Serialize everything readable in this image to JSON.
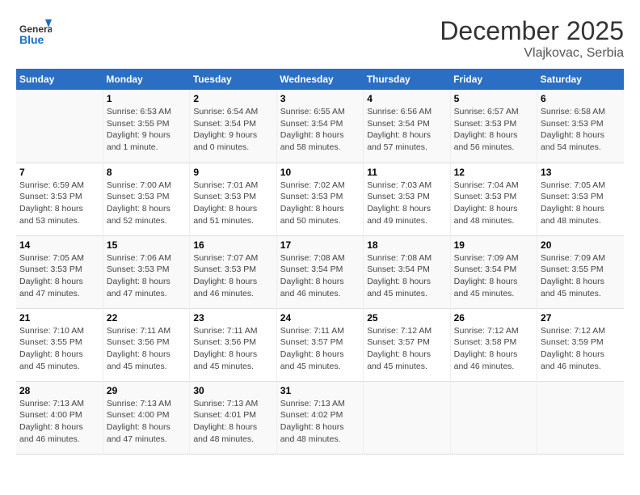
{
  "header": {
    "logo_line1": "General",
    "logo_line2": "Blue",
    "month": "December 2025",
    "location": "Vlajkovac, Serbia"
  },
  "days_of_week": [
    "Sunday",
    "Monday",
    "Tuesday",
    "Wednesday",
    "Thursday",
    "Friday",
    "Saturday"
  ],
  "weeks": [
    [
      {
        "day": "",
        "info": ""
      },
      {
        "day": "1",
        "info": "Sunrise: 6:53 AM\nSunset: 3:55 PM\nDaylight: 9 hours\nand 1 minute."
      },
      {
        "day": "2",
        "info": "Sunrise: 6:54 AM\nSunset: 3:54 PM\nDaylight: 9 hours\nand 0 minutes."
      },
      {
        "day": "3",
        "info": "Sunrise: 6:55 AM\nSunset: 3:54 PM\nDaylight: 8 hours\nand 58 minutes."
      },
      {
        "day": "4",
        "info": "Sunrise: 6:56 AM\nSunset: 3:54 PM\nDaylight: 8 hours\nand 57 minutes."
      },
      {
        "day": "5",
        "info": "Sunrise: 6:57 AM\nSunset: 3:53 PM\nDaylight: 8 hours\nand 56 minutes."
      },
      {
        "day": "6",
        "info": "Sunrise: 6:58 AM\nSunset: 3:53 PM\nDaylight: 8 hours\nand 54 minutes."
      }
    ],
    [
      {
        "day": "7",
        "info": "Sunrise: 6:59 AM\nSunset: 3:53 PM\nDaylight: 8 hours\nand 53 minutes."
      },
      {
        "day": "8",
        "info": "Sunrise: 7:00 AM\nSunset: 3:53 PM\nDaylight: 8 hours\nand 52 minutes."
      },
      {
        "day": "9",
        "info": "Sunrise: 7:01 AM\nSunset: 3:53 PM\nDaylight: 8 hours\nand 51 minutes."
      },
      {
        "day": "10",
        "info": "Sunrise: 7:02 AM\nSunset: 3:53 PM\nDaylight: 8 hours\nand 50 minutes."
      },
      {
        "day": "11",
        "info": "Sunrise: 7:03 AM\nSunset: 3:53 PM\nDaylight: 8 hours\nand 49 minutes."
      },
      {
        "day": "12",
        "info": "Sunrise: 7:04 AM\nSunset: 3:53 PM\nDaylight: 8 hours\nand 48 minutes."
      },
      {
        "day": "13",
        "info": "Sunrise: 7:05 AM\nSunset: 3:53 PM\nDaylight: 8 hours\nand 48 minutes."
      }
    ],
    [
      {
        "day": "14",
        "info": "Sunrise: 7:05 AM\nSunset: 3:53 PM\nDaylight: 8 hours\nand 47 minutes."
      },
      {
        "day": "15",
        "info": "Sunrise: 7:06 AM\nSunset: 3:53 PM\nDaylight: 8 hours\nand 47 minutes."
      },
      {
        "day": "16",
        "info": "Sunrise: 7:07 AM\nSunset: 3:53 PM\nDaylight: 8 hours\nand 46 minutes."
      },
      {
        "day": "17",
        "info": "Sunrise: 7:08 AM\nSunset: 3:54 PM\nDaylight: 8 hours\nand 46 minutes."
      },
      {
        "day": "18",
        "info": "Sunrise: 7:08 AM\nSunset: 3:54 PM\nDaylight: 8 hours\nand 45 minutes."
      },
      {
        "day": "19",
        "info": "Sunrise: 7:09 AM\nSunset: 3:54 PM\nDaylight: 8 hours\nand 45 minutes."
      },
      {
        "day": "20",
        "info": "Sunrise: 7:09 AM\nSunset: 3:55 PM\nDaylight: 8 hours\nand 45 minutes."
      }
    ],
    [
      {
        "day": "21",
        "info": "Sunrise: 7:10 AM\nSunset: 3:55 PM\nDaylight: 8 hours\nand 45 minutes."
      },
      {
        "day": "22",
        "info": "Sunrise: 7:11 AM\nSunset: 3:56 PM\nDaylight: 8 hours\nand 45 minutes."
      },
      {
        "day": "23",
        "info": "Sunrise: 7:11 AM\nSunset: 3:56 PM\nDaylight: 8 hours\nand 45 minutes."
      },
      {
        "day": "24",
        "info": "Sunrise: 7:11 AM\nSunset: 3:57 PM\nDaylight: 8 hours\nand 45 minutes."
      },
      {
        "day": "25",
        "info": "Sunrise: 7:12 AM\nSunset: 3:57 PM\nDaylight: 8 hours\nand 45 minutes."
      },
      {
        "day": "26",
        "info": "Sunrise: 7:12 AM\nSunset: 3:58 PM\nDaylight: 8 hours\nand 46 minutes."
      },
      {
        "day": "27",
        "info": "Sunrise: 7:12 AM\nSunset: 3:59 PM\nDaylight: 8 hours\nand 46 minutes."
      }
    ],
    [
      {
        "day": "28",
        "info": "Sunrise: 7:13 AM\nSunset: 4:00 PM\nDaylight: 8 hours\nand 46 minutes."
      },
      {
        "day": "29",
        "info": "Sunrise: 7:13 AM\nSunset: 4:00 PM\nDaylight: 8 hours\nand 47 minutes."
      },
      {
        "day": "30",
        "info": "Sunrise: 7:13 AM\nSunset: 4:01 PM\nDaylight: 8 hours\nand 48 minutes."
      },
      {
        "day": "31",
        "info": "Sunrise: 7:13 AM\nSunset: 4:02 PM\nDaylight: 8 hours\nand 48 minutes."
      },
      {
        "day": "",
        "info": ""
      },
      {
        "day": "",
        "info": ""
      },
      {
        "day": "",
        "info": ""
      }
    ]
  ]
}
